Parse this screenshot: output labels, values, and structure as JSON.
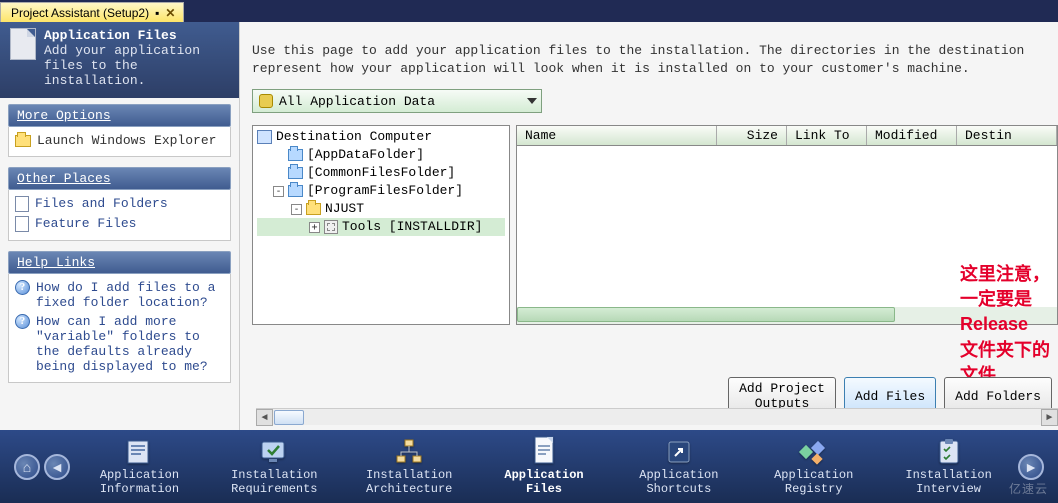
{
  "tab": {
    "title": "Project Assistant (Setup2)"
  },
  "sidebar": {
    "header": {
      "title": "Application Files",
      "desc": "Add your application files to the installation."
    },
    "sections": {
      "more_options": {
        "title": "More Options",
        "items": [
          "Launch Windows Explorer"
        ]
      },
      "other_places": {
        "title": "Other Places",
        "items": [
          "Files and Folders",
          "Feature Files"
        ]
      },
      "help_links": {
        "title": "Help Links",
        "items": [
          "How do I add files to a fixed folder location?",
          "How can I add more \"variable\" folders to the defaults already being displayed to me?"
        ]
      }
    }
  },
  "main": {
    "intro": "Use this page to add your application files to the installation. The directories in the destination represent how your application will look when it is installed on to your customer's machine.",
    "dropdown_value": "All Application Data",
    "tree": {
      "root": "Destination Computer",
      "n1": "[AppDataFolder]",
      "n2": "[CommonFilesFolder]",
      "n3": "[ProgramFilesFolder]",
      "n3a": "NJUST",
      "n3a1": "Tools [INSTALLDIR]"
    },
    "list_cols": {
      "name": "Name",
      "size": "Size",
      "link": "Link To",
      "mod": "Modified",
      "dest": "Destin"
    },
    "buttons": {
      "add_outputs_l1": "Add Project",
      "add_outputs_l2": "Outputs",
      "add_files": "Add Files",
      "add_folders": "Add Folders"
    },
    "annotation": {
      "line1": "这里注意，一定要是Release",
      "line2": "文件夹下的文件"
    }
  },
  "bottom_nav": {
    "items": [
      {
        "label": "Application\nInformation"
      },
      {
        "label": "Installation\nRequirements"
      },
      {
        "label": "Installation\nArchitecture"
      },
      {
        "label": "Application\nFiles"
      },
      {
        "label": "Application\nShortcuts"
      },
      {
        "label": "Application\nRegistry"
      },
      {
        "label": "Installation\nInterview"
      }
    ]
  },
  "watermark": "亿速云"
}
